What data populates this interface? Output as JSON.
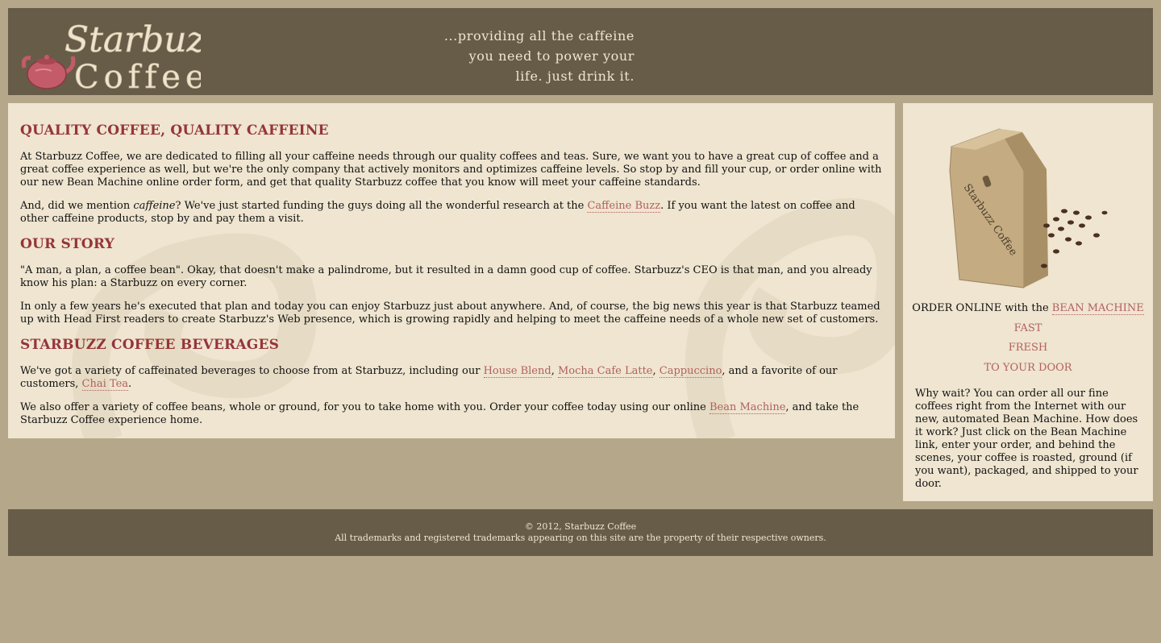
{
  "header": {
    "logo_text": "Starbuzz Coffee",
    "slogan_lines": [
      "...providing all the caffeine",
      "you need to power your",
      "life. just drink it."
    ]
  },
  "main": {
    "sections": [
      {
        "heading": "QUALITY COFFEE, QUALITY CAFFEINE",
        "p1": "At Starbuzz Coffee, we are dedicated to filling all your caffeine needs through our quality coffees and teas. Sure, we want you to have a great cup of coffee and a great coffee experience as well, but we're the only company that actively monitors and optimizes caffeine levels. So stop by and fill your cup, or order online with our new Bean Machine online order form, and get that quality Starbuzz coffee that you know will meet your caffeine standards.",
        "p2_a": "And, did we mention ",
        "p2_em": "caffeine",
        "p2_b": "? We've just started funding the guys doing all the wonderful research at the ",
        "p2_link": "Caffeine Buzz",
        "p2_c": ". If you want the latest on coffee and other caffeine products, stop by and pay them a visit."
      },
      {
        "heading": "OUR STORY",
        "p1": "\"A man, a plan, a coffee bean\". Okay, that doesn't make a palindrome, but it resulted in a damn good cup of coffee. Starbuzz's CEO is that man, and you already know his plan: a Starbuzz on every corner.",
        "p2": "In only a few years he's executed that plan and today you can enjoy Starbuzz just about anywhere. And, of course, the big news this year is that Starbuzz teamed up with Head First readers to create Starbuzz's Web presence, which is growing rapidly and helping to meet the caffeine needs of a whole new set of customers."
      },
      {
        "heading": "STARBUZZ COFFEE BEVERAGES",
        "p1_a": "We've got a variety of caffeinated beverages to choose from at Starbuzz, including our ",
        "link_house": "House Blend",
        "sep1": ", ",
        "link_mocha": "Mocha Cafe Latte",
        "sep2": ", ",
        "link_cappuccino": "Cappuccino",
        "p1_b": ", and a favorite of our customers, ",
        "link_chai": "Chai Tea",
        "p1_c": ".",
        "p2_a": "We also offer a variety of coffee beans, whole or ground, for you to take home with you. Order your coffee today using our online ",
        "link_bean": "Bean Machine",
        "p2_b": ", and take the Starbuzz Coffee experience home."
      }
    ]
  },
  "sidebar": {
    "bag_text": "Starbuzz Coffee",
    "order_prefix": "ORDER ONLINE with the ",
    "order_link": "BEAN MACHINE",
    "features": [
      "FAST",
      "FRESH",
      "TO YOUR DOOR"
    ],
    "why": "Why wait? You can order all our fine coffees right from the Internet with our new, automated Bean Machine. How does it work? Just click on the Bean Machine link, enter your order, and behind the scenes, your coffee is roasted, ground (if you want), packaged, and shipped to your door."
  },
  "footer": {
    "copyright": "© 2012, Starbuzz Coffee",
    "trademark": "All trademarks and registered trademarks appearing on this site are the property of their respective owners."
  },
  "colors": {
    "page_bg": "#b5a789",
    "header_bg": "#675c47",
    "panel_bg": "#efe5d0",
    "heading": "#953539",
    "link": "#b2605e"
  }
}
